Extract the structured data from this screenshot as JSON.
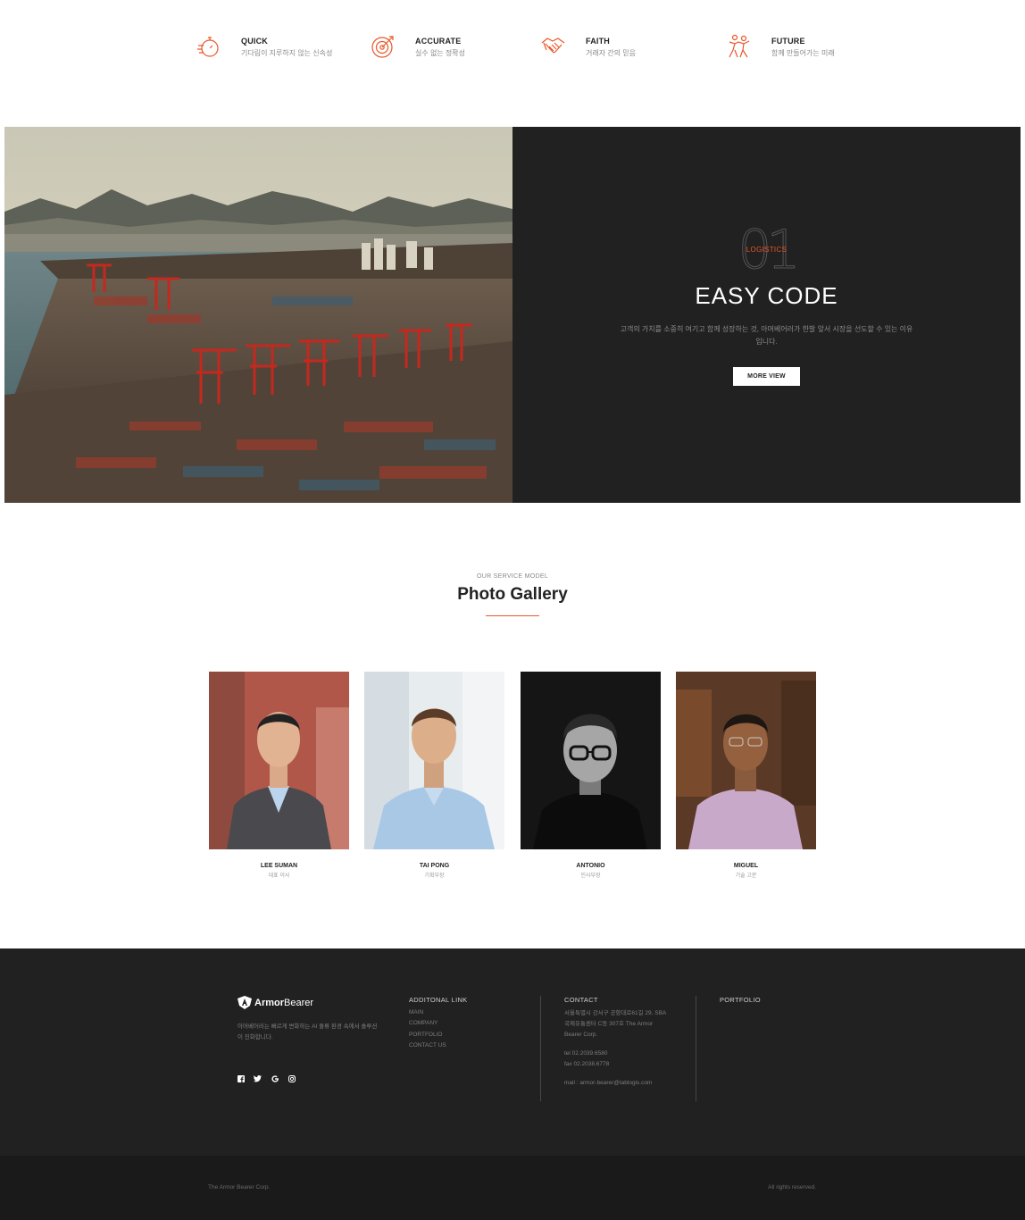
{
  "features": [
    {
      "icon": "stopwatch-icon",
      "title": "QUICK",
      "subtitle": "기다림이 지루하지 않는 신속성"
    },
    {
      "icon": "target-icon",
      "title": "ACCURATE",
      "subtitle": "실수 없는 정확성"
    },
    {
      "icon": "handshake-icon",
      "title": "FAITH",
      "subtitle": "거래자 간의 믿음"
    },
    {
      "icon": "people-icon",
      "title": "FUTURE",
      "subtitle": "함께 만들어가는 미래"
    }
  ],
  "hero": {
    "number": "01",
    "eyebrow": "LOGISTICS",
    "title": "EASY CODE",
    "description": "고객의 가치를 소중히 여기고 함께 성장하는 것, 아머베어러가 한발 앞서 시장을 선도할 수 있는 이유입니다.",
    "button_label": "MORE VIEW"
  },
  "gallery": {
    "eyebrow": "OUR SERVICE MODEL",
    "title": "Photo Gallery",
    "members": [
      {
        "name": "LEE SUMAN",
        "role": "대표 이사"
      },
      {
        "name": "TAI PONG",
        "role": "기획부장"
      },
      {
        "name": "ANTONIO",
        "role": "인사부장"
      },
      {
        "name": "MIGUEL",
        "role": "기술 고문"
      }
    ]
  },
  "footer": {
    "logo_bold": "Armor",
    "logo_rest": "Bearer",
    "about": "아머베어러는 빠르게 변화하는 AI 물류 환경 속에서 솔루션이 진화합니다.",
    "socials": [
      "facebook-icon",
      "twitter-icon",
      "google-icon",
      "instagram-icon"
    ],
    "links_title": "ADDITONAL LINK",
    "links": [
      "MAIN",
      "COMPANY",
      "PORTFOLIO",
      "CONTACT US"
    ],
    "contact_title": "CONTACT",
    "address": "서울특별시 강서구 공항대로61길 29, SBA 국제유통센터 C동 307호 The Armor Bearer Corp.",
    "tel": "tel 02.2039.6580",
    "fax": "fax 02.2038.6778",
    "mail": "mail : armor-bearer@tablogis.com",
    "portfolio_title": "PORTFOLIO",
    "copyright": "The Armor Bearer Corp.",
    "rights": "All rights reserved."
  },
  "colors": {
    "accent": "#e9572a",
    "dark": "#212121"
  }
}
